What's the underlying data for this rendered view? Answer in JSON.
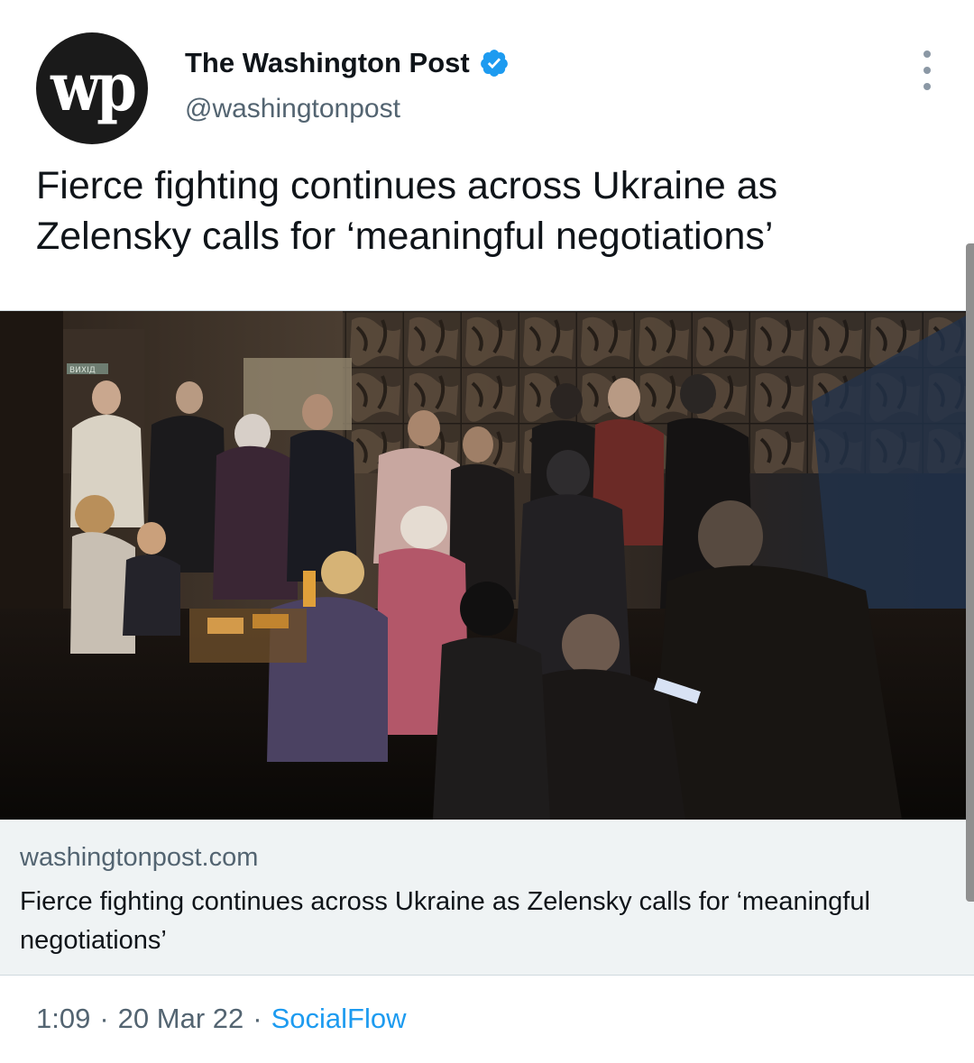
{
  "author": {
    "display_name": "The Washington Post",
    "handle": "@washingtonpost",
    "avatar_text": "wp",
    "verified": true
  },
  "tweet": {
    "text": "Fierce fighting continues across Ukraine as Zelensky calls for ‘meaningful negotiations’"
  },
  "card": {
    "domain": "washingtonpost.com",
    "title": "Fierce fighting continues across Ukraine as Zelensky calls for ‘meaningful negotiations’",
    "image_sign_text": "ВИХІД"
  },
  "meta": {
    "time": "1:09",
    "separator": "·",
    "date": "20 Mar 22",
    "source": "SocialFlow"
  },
  "colors": {
    "accent": "#1d9bf0",
    "secondary_text": "#536471",
    "card_background": "#eff3f4"
  },
  "icons": {
    "verified": "verified-badge-icon",
    "more": "more-vertical-icon"
  }
}
